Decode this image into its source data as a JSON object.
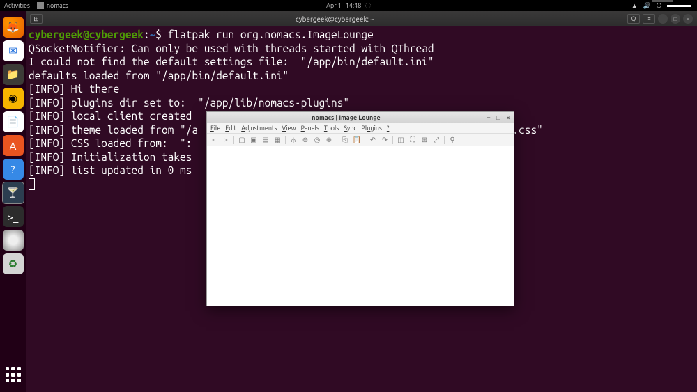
{
  "topbar": {
    "activities": "Activities",
    "app_name": "nomacs",
    "date": "Apr 1",
    "time": "14:48"
  },
  "terminal": {
    "window_title": "cybergeek@cybergeek: ~",
    "prompt_user": "cybergeek@cybergeek",
    "prompt_path": "~",
    "command": "flatpak run org.nomacs.ImageLounge",
    "lines": [
      "QSocketNotifier: Can only be used with threads started with QThread",
      "I could not find the default settings file:  \"/app/bin/default.ini\"",
      "defaults loaded from \"/app/bin/default.ini\"",
      "[INFO] Hi there",
      "[INFO] plugins dir set to:  \"/app/lib/nomacs-plugins\"",
      "[INFO] local client created",
      "[INFO] theme loaded from \"/a                                                   e.css\"",
      "[INFO] CSS loaded from:  \":",
      "[INFO] Initialization takes",
      "[INFO] list updated in 0 ms"
    ]
  },
  "nomacs": {
    "title": "nomacs | Image Lounge",
    "menu": [
      "File",
      "Edit",
      "Adjustments",
      "View",
      "Panels",
      "Tools",
      "Sync",
      "Plugins",
      "?"
    ],
    "toolbar_icons": [
      "prev",
      "next",
      "sep",
      "open",
      "open-folder",
      "save",
      "toggle",
      "sep",
      "filter",
      "zoom-out",
      "zoom-100",
      "zoom-in",
      "sep",
      "copy",
      "paste",
      "sep",
      "undo",
      "redo",
      "sep",
      "crop",
      "fullscreen",
      "grid",
      "panorama",
      "sep",
      "gps"
    ]
  },
  "dock": {
    "items": [
      "firefox",
      "thunderbird",
      "files",
      "rhythmbox",
      "libreoffice",
      "software",
      "help",
      "nomacs",
      "terminal",
      "disc",
      "trash"
    ]
  }
}
